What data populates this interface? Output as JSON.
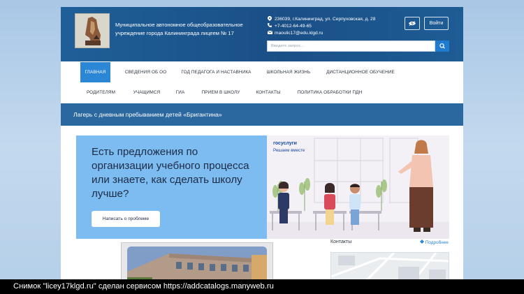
{
  "header": {
    "org_line1": "Муниципальное автономное общеобразовательное",
    "org_line2": "учреждение города Калининграда лицеем № 17",
    "address": "236039, г.Калининград, ул. Серпуховская, д. 28",
    "phone": "+7-4012-64-49-65",
    "email": "maoulic17@edu.klgd.ru",
    "eye_icon": "eye-icon",
    "login_label": "Войти",
    "search_placeholder": "Введите запрос..."
  },
  "nav": {
    "row1": [
      "ГЛАВНАЯ",
      "СВЕДЕНИЯ ОБ ОО",
      "ГОД ПЕДАГОГА И НАСТАВНИКА",
      "ШКОЛЬНАЯ ЖИЗНЬ",
      "ДИСТАНЦИОННОЕ ОБУЧЕНИЕ"
    ],
    "row2": [
      "РОДИТЕЛЯМ",
      "УЧАЩИМСЯ",
      "ГИА",
      "ПРИЕМ В ШКОЛУ",
      "КОНТАКТЫ",
      "ПОЛИТИКА ОБРАБОТКИ ПДН"
    ],
    "active": "ГЛАВНАЯ"
  },
  "banner": {
    "text": "Лагерь с дневным пребыванием детей «Бригантина»"
  },
  "promo": {
    "title_line1": "Есть предложения по",
    "title_line2": "организации учебного процесса",
    "title_line3": "или знаете, как сделать школу",
    "title_line4": "лучше?",
    "button_label": "Написать о проблеме",
    "gosuslugi_logo": "госуслуги",
    "gosuslugi_sub": "Решаем вместе"
  },
  "sidebar": {
    "contacts_heading": "Контакты",
    "more_link": "Подробнее"
  },
  "caption": {
    "text": "Снимок \"licey17klgd.ru\" сделан сервисом https://addcatalogs.manyweb.ru"
  },
  "colors": {
    "header_bg": "#1a4f86",
    "nav_active": "#2b86d6",
    "banner_bg": "#2b68a0",
    "promo_bg": "#7dbcf1"
  }
}
